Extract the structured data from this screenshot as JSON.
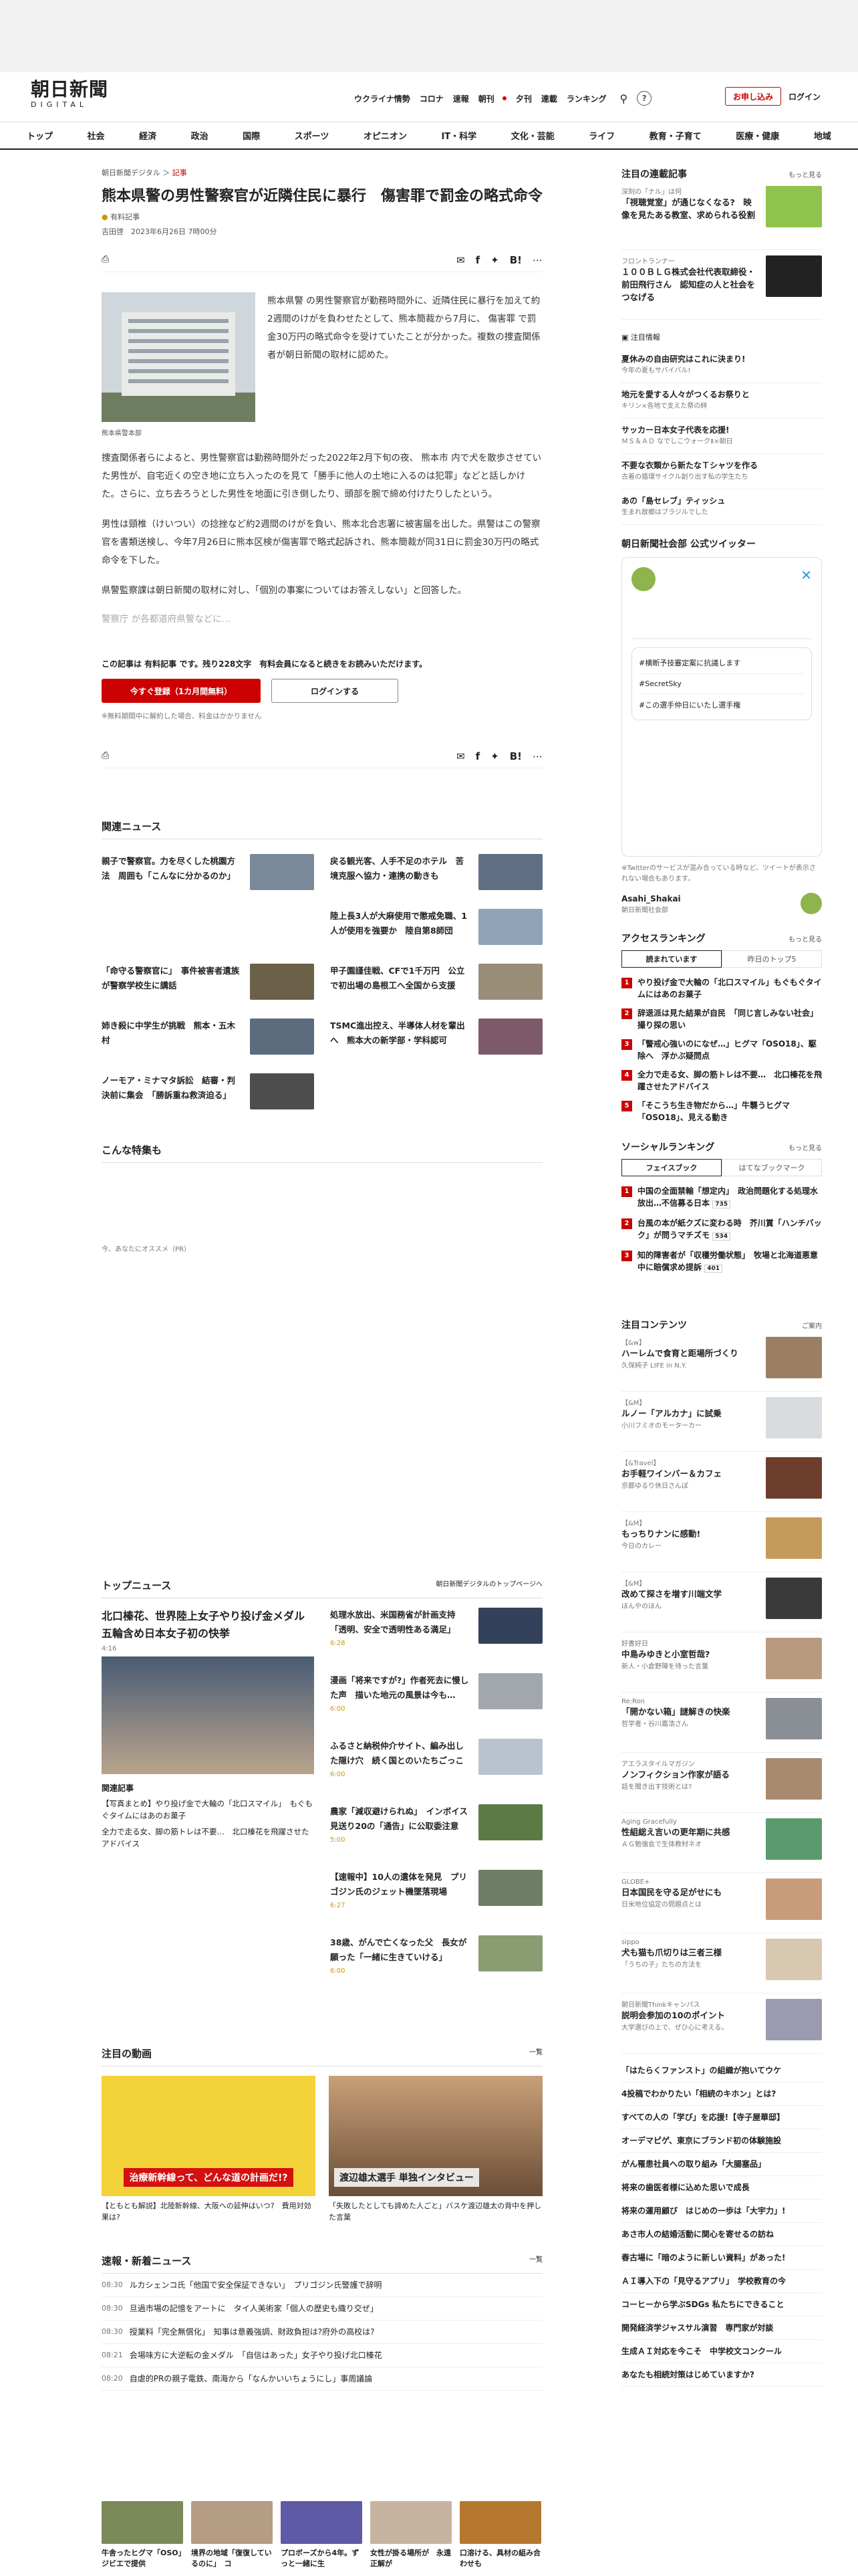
{
  "header": {
    "logo_main": "朝日新聞",
    "logo_sub": "DIGITAL",
    "top_links": [
      "ウクライナ情勢",
      "コロナ",
      "速報",
      "朝刊",
      "夕刊",
      "連載",
      "ランキング"
    ],
    "subscribe": "お申し込み",
    "login": "ログイン"
  },
  "nav": [
    "トップ",
    "社会",
    "経済",
    "政治",
    "国際",
    "スポーツ",
    "オピニオン",
    "IT・科学",
    "文化・芸能",
    "ライフ",
    "教育・子育て",
    "医療・健康",
    "地域"
  ],
  "article": {
    "crumb_site": "朝日新聞デジタル",
    "crumb_section": "記事",
    "title": "熊本県警の男性警察官が近隣住民に暴行　傷害罪で罰金の略式命令",
    "paid": "有料記事",
    "byline": "吉田啓　2023年6月26日 7時00分",
    "caption": "熊本県警本部",
    "lead": "熊本県警 の男性警察官が勤務時間外に、近隣住民に暴行を加えて約2週間のけがを負わせたとして、熊本簡裁から7月に、 傷害罪 で罰金30万円の略式命令を受けていたことが分かった。複数の捜査関係者が朝日新聞の取材に認めた。",
    "p2": "捜査関係者らによると、男性警察官は勤務時間外だった2022年2月下旬の夜、 熊本市 内で犬を散歩させていた男性が、自宅近くの空き地に立ち入ったのを見て「勝手に他人の土地に入るのは犯罪」などと話しかけた。さらに、立ち去ろうとした男性を地面に引き倒したり、頭部を腕で締め付けたりしたという。",
    "p3": "男性は頸椎（けいつい）の捻挫など約2週間のけがを負い、熊本北合志署に被害届を出した。県警はこの警察官を書類送検し、今年7月26日に熊本区検が傷害罪で略式起訴され、熊本簡裁が同31日に罰金30万円の略式命令を下した。",
    "p4": "県警監察課は朝日新聞の取材に対し、「個別の事案についてはお答えしない」と回答した。",
    "fade": "警察庁 が各都道府県警などに…",
    "paywall": "この記事は 有料記事 です。残り228文字　有料会員になると続きをお読みいただけます。",
    "register": "今すぐ登録（1カ月間無料）",
    "login_btn": "ログインする",
    "note": "※無料期間中に解約した場合、料金はかかりません",
    "share_count": "5"
  },
  "related": {
    "title": "関連ニュース",
    "items": [
      "親子で警察官。力を尽くした桃園方法　周囲も「こんなに分かるのか」",
      "戻る観光客、人手不足のホテル　苦境克服へ協力・連携の動きも",
      "陸上長3人が大麻使用で懲戒免職、1人が使用を強要か　陸自第8師団",
      "「命守る警察官に」　事件被害者遺族が警察学校生に講話",
      "甲子園謹佳戦、CFで1千万円　公立で初出場の島根工へ全国から支援",
      "姉き殺に中学生が挑戦　熊本・五木村",
      "TSMC進出控え、半導体人材を輩出へ　熊本大の新学部・学科認可",
      "ノーモア・ミナマタ訴訟　結審・判決前に集会　「勝訴重ね救済迫る」"
    ]
  },
  "special": {
    "title": "こんな特集も"
  },
  "pr": {
    "label": "今、あなたにオススメ（PR）"
  },
  "top_news": {
    "title": "トップニュース",
    "more": "朝日新聞デジタルのトップページへ",
    "headline": "北口榛花、世界陸上女子やり投げ金メダル　五輪含め日本女子初の快挙",
    "time": "4:16",
    "related_title": "関連記事",
    "related": [
      "【写真まとめ】やり投げ金で大輪の「北口スマイル」　もぐもぐタイムにはあのお菓子",
      "全力で走る女、脚の筋トレは不要…　北口榛花を飛躍させたアドバイス"
    ],
    "items": [
      {
        "t": "処理水放出、米国務省が計画支持　「透明、安全で透明性ある満足」",
        "d": "6:28"
      },
      {
        "t": "漫画「将来ですが?」作者死去に慢した声　描いた地元の風景は今も…",
        "d": "6:00"
      },
      {
        "t": "ふるさと納税仲介サイト、編み出した隠け穴　続く国とのいたちごっこ",
        "d": "6:00"
      },
      {
        "t": "農家「減収避けられぬ」　インボイス見送り20の「通告」に公取委注意",
        "d": "5:00"
      },
      {
        "t": "【速報中】10人の遺体を発見　プリゴジン氏のジェット機墜落現場",
        "d": "6:27"
      },
      {
        "t": "38歳、がんで亡くなった父　長女が願った「一緒に生きていける」",
        "d": "6:00"
      }
    ]
  },
  "video": {
    "title": "注目の動画",
    "more": "一覧",
    "items": [
      "【ともとも解説】北陸新幹線、大阪への延伸はいつ?　費用対効果は?",
      "「失敗したとしても諦めた人ごと」バスケ渡辺雄太の背中を押した言葉"
    ],
    "poster1": "治療新幹線って、どんな道の計画だ!?",
    "poster2": "渡辺雄太選手 単独インタビュー"
  },
  "breaking": {
    "title": "速報・新着ニュース",
    "more": "一覧",
    "items": [
      {
        "t": "08:30",
        "h": "ルカシェンコ氏「他国で安全保証できない」　プリゴジン氏警護で辞明"
      },
      {
        "t": "08:30",
        "h": "旦過市場の記憶をアートに　タイ人美術家「個人の歴史も織り交ぜ」"
      },
      {
        "t": "08:30",
        "h": "授業料「完全無償化」　知事は意義強調、財政負担は?府外の高校は?"
      },
      {
        "t": "08:21",
        "h": "会場味方に大逆転の金メダル　「自信はあった」女子やり投げ北口榛花"
      },
      {
        "t": "08:20",
        "h": "自虐的PRの親子電鉄、南海から「なんかいいちょうにし」事周議論"
      }
    ]
  },
  "features_strip": [
    "牛舎ったヒグマ「OSO」　ジビエで提供",
    "境界の地域「復復しているのに」　コ",
    "プロボーズから4年。ずっと一緒に生",
    "女性が掛る場所が　永遠正解が",
    "口溶ける、具材の組み合わせも"
  ],
  "sidebar": {
    "series_title": "注目の連載記事",
    "more": "もっと見る",
    "series": [
      {
        "k": "深刻の「ナル」は何",
        "t": "「視聴覚室」が通じなくなる?　映像を見たある教室、求められる役割"
      },
      {
        "k": "フロントランナー",
        "t": "１００ＢＬＧ株式会社代表取締役・前田飛行さん　認知症の人と社会をつなげる"
      }
    ],
    "info_title": "注目情報",
    "info": [
      {
        "t": "夏休みの自由研究はこれに決まり!",
        "s": "今年の夏もサバイバル!"
      },
      {
        "t": "地元を愛する人々がつくるお祭りと",
        "s": "キリン×各地で支えた祭の絆"
      },
      {
        "t": "サッカー日本女子代表を応援!",
        "s": "ＭＳ＆ＡＤ なでしこウォークⅡ×朝日"
      },
      {
        "t": "不要な衣類から新たなＴシャツを作る",
        "s": "古着の循環サイクル創り出す私の学生たち"
      },
      {
        "t": "あの「島セレブ」ティッシュ",
        "s": "生まれ故郷はブラジルでした"
      }
    ],
    "twitter_title": "朝日新聞社会部 公式ツイッター",
    "twitter_note": "※Twitterのサービスが混み合っている時など、ツイートが表示されない場合もあります。",
    "twitter_handle": "Asahi_Shakai",
    "twitter_desc": "朝日新聞社会部",
    "tw_items": [
      "#横断予技審定案に抗議します",
      "#SecretSky",
      "#この選手仲日にいたし選手権"
    ],
    "access_title": "アクセスランキング",
    "access_tabs": [
      "読まれています",
      "昨日のトップ5"
    ],
    "access": [
      "やり投げ金で大輪の「北口スマイル」もぐもぐタイムにはあのお菓子",
      "辞退派は見た結果が自民　「同じ言しみない社会」撮り探の思い",
      "「警戒心強いのになぜ…」ヒグマ「OSO18」、駆除へ　浮かぶ疑問点",
      "全力で走る女、脚の筋トレは不要…　北口榛花を飛躍させたアドバイス",
      "「そこうち生き物だから…」牛襲うヒグマ「OSO18」、見える動き"
    ],
    "social_title": "ソーシャルランキング",
    "social_tabs": [
      "フェイスブック",
      "はてなブックマーク"
    ],
    "social": [
      "中国の全面禁輸「想定内」　政治問題化する処理水放出…不信募る日本",
      "台風の本が紙クズに変わる時　芥川賞「ハンチバック」が問うマチズモ",
      "知的障害者が「収穫労働状態」　牧場と北海道悪意中に賠償求め提訴"
    ],
    "social_counts": [
      "735",
      "534",
      "401"
    ],
    "content_title": "注目コンテンツ",
    "content_more": "ご案内",
    "contents": [
      {
        "k": "【&w】",
        "t": "ハーレムで食育と距場所づくり",
        "s": "久保純子 LIFE in N.Y."
      },
      {
        "k": "【&M】",
        "t": "ルノー「アルカナ」に試乗",
        "s": "小川フミオのモーターカー"
      },
      {
        "k": "【&Travel】",
        "t": "お手軽ワインバー＆カフェ",
        "s": "京都ゆるり休日さんぽ"
      },
      {
        "k": "【&M】",
        "t": "もっちりナンに感動!",
        "s": "今日のカレー"
      },
      {
        "k": "【&M】",
        "t": "改めて探さを増す川端文学",
        "s": "ほんやのほん"
      },
      {
        "k": "好書好日",
        "t": "中島みゆきと小室哲哉?",
        "s": "新人・小倉野陣を待った言葉"
      },
      {
        "k": "Re:Ron",
        "t": "「開かない箱」謎解きの快楽",
        "s": "哲学者・谷川嘉浩さん"
      },
      {
        "k": "アエラスタイルマガジン",
        "t": "ノンフィクション作家が語る",
        "s": "話を聞き出す技術とは?"
      },
      {
        "k": "Aging Gracefully",
        "t": "性組総え言いの更年期に共感",
        "s": "ＡＧ勉強会で生体教材ネオ"
      },
      {
        "k": "GLOBE+",
        "t": "日本国民を守る足がせにも",
        "s": "日米地位協定の問題点とは"
      },
      {
        "k": "sippo",
        "t": "犬も猫も爪切りは三者三様",
        "s": "「うちの子」たちの方法を"
      },
      {
        "k": "朝日新聞Thinkキャンパス",
        "t": "説明会参加の10のポイント",
        "s": "大学選びの上で、ぜひ心に考える。"
      }
    ],
    "links": [
      "「はたらくファンスト」の組織が抱いてウケ",
      "4投稿でわかりたい「相続のキホン」とは?",
      "すべての人の「学び」を応援!【寺子屋華邸】",
      "オーデマピゲ、東京にブランド初の体験施設",
      "がん罹患社員への取り組み「大腸塞品」",
      "将来の歯医者様に込めた思いで成長",
      "将来の運用顧び　はじめの一歩は「大宇力」!",
      "あさ市人の結婚活動に関心を寄せるの訪ね",
      "春古場に「暗のように新しい資料」があった!",
      "ＡＩ導入下の「見守るアプリ」　学校教育の今",
      "コーヒーから学ぶSDGs 私たちにできること",
      "開発経済学ジャスサル演習　専門家が対談",
      "生成ＡＩ対応を今こそ　中学校文コンクール",
      "あなたも相続対策はじめていますか?"
    ]
  }
}
